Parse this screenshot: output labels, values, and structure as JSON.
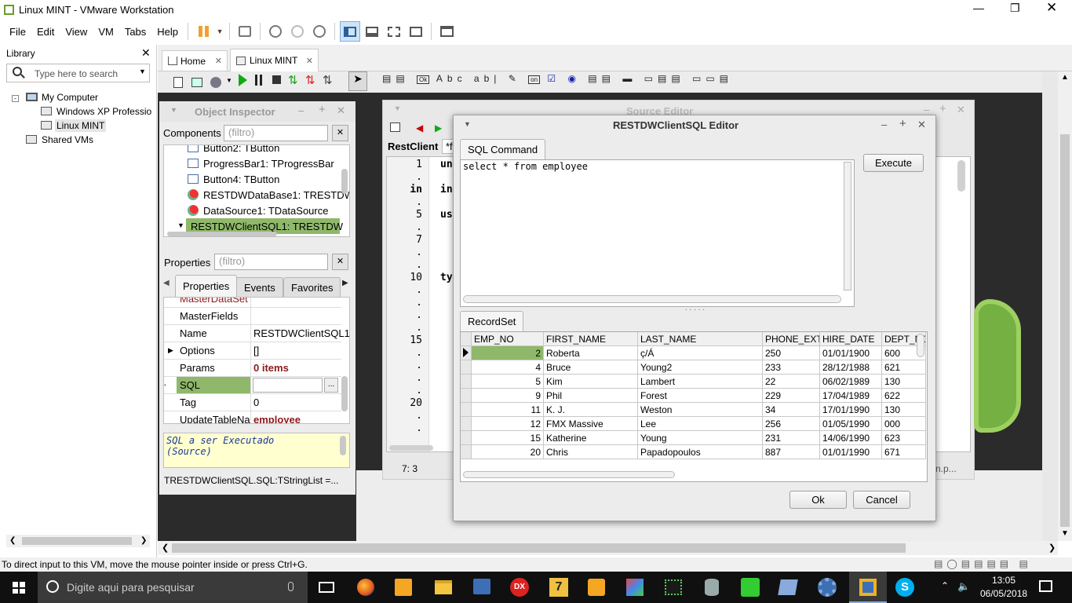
{
  "window": {
    "title": "Linux MINT - VMware Workstation"
  },
  "menubar": {
    "items": [
      "File",
      "Edit",
      "View",
      "VM",
      "Tabs",
      "Help"
    ]
  },
  "library": {
    "header": "Library",
    "search_placeholder": "Type here to search",
    "tree": {
      "root": "My Computer",
      "children": [
        "Windows XP Professio",
        "Linux MINT"
      ],
      "shared": "Shared VMs"
    }
  },
  "tabs": {
    "home": "Home",
    "vm": "Linux MINT"
  },
  "object_inspector": {
    "title": "Object Inspector",
    "components_label": "Components",
    "filter_placeholder": "(filtro)",
    "components": [
      "Button2: TButton",
      "ProgressBar1: TProgressBar",
      "Button4: TButton",
      "RESTDWDataBase1: TRESTDW",
      "DataSource1: TDataSource",
      "RESTDWClientSQL1: TRESTDW"
    ],
    "properties_label": "Properties",
    "tabs": [
      "Properties",
      "Events",
      "Favorites"
    ],
    "props": [
      {
        "name": "MasterDataSet",
        "value": ""
      },
      {
        "name": "MasterFields",
        "value": ""
      },
      {
        "name": "Name",
        "value": "RESTDWClientSQL1"
      },
      {
        "name": "Options",
        "value": "[]"
      },
      {
        "name": "Params",
        "value": "0 items"
      },
      {
        "name": "SQL",
        "value": ""
      },
      {
        "name": "Tag",
        "value": "0"
      },
      {
        "name": "UpdateTableNa",
        "value": "employee"
      }
    ],
    "hint_line1": "SQL a ser Executado",
    "hint_line2": "(Source)",
    "status": "TRESTDWClientSQL.SQL:TStringList =..."
  },
  "source_editor": {
    "title": "Source Editor",
    "tab1": "RestClient",
    "tab2": "*f",
    "line_numbers": [
      "1",
      ".",
      "in",
      ".",
      "5",
      ".",
      "7",
      ".",
      ".",
      "10",
      ".",
      ".",
      ".",
      ".",
      "15",
      ".",
      ".",
      ".",
      ".",
      "20",
      ".",
      "."
    ],
    "code_frags": [
      "un",
      "in",
      "us",
      "ty"
    ],
    "cursor_pos": "7: 3",
    "right_frag": "n.p..."
  },
  "dialog": {
    "title": "RESTDWClientSQL Editor",
    "sql_tab": "SQL Command",
    "sql_text": "select * from employee",
    "execute": "Execute",
    "recordset_tab": "RecordSet",
    "columns": [
      "EMP_NO",
      "FIRST_NAME",
      "LAST_NAME",
      "PHONE_EXT",
      "HIRE_DATE",
      "DEPT_NO"
    ],
    "rows": [
      [
        "2",
        "Roberta",
        "ç/Á",
        "250",
        "01/01/1900",
        "600"
      ],
      [
        "4",
        "Bruce",
        "Young2",
        "233",
        "28/12/1988",
        "621"
      ],
      [
        "5",
        "Kim",
        "Lambert",
        "22",
        "06/02/1989",
        "130"
      ],
      [
        "9",
        "Phil",
        "Forest",
        "229",
        "17/04/1989",
        "622"
      ],
      [
        "11",
        "K. J.",
        "Weston",
        "34",
        "17/01/1990",
        "130"
      ],
      [
        "12",
        "FMX Massive",
        "Lee",
        "256",
        "01/05/1990",
        "000"
      ],
      [
        "15",
        "Katherine",
        "Young",
        "231",
        "14/06/1990",
        "623"
      ],
      [
        "20",
        "Chris",
        "Papadopoulos",
        "887",
        "01/01/1990",
        "671"
      ]
    ],
    "ok": "Ok",
    "cancel": "Cancel"
  },
  "status_bar": {
    "text": "To direct input to this VM, move the mouse pointer inside or press Ctrl+G."
  },
  "taskbar": {
    "search_placeholder": "Digite aqui para pesquisar",
    "time": "13:05",
    "date": "06/05/2018"
  }
}
